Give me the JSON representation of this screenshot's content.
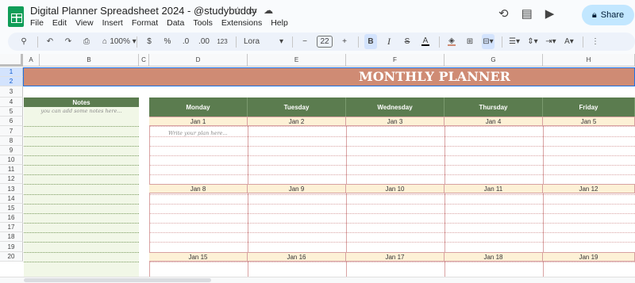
{
  "app": {
    "doc_title": "Digital Planner Spreadsheet 2024 - @studybuddy",
    "share_label": "Share",
    "menu": [
      "File",
      "Edit",
      "View",
      "Insert",
      "Format",
      "Data",
      "Tools",
      "Extensions",
      "Help"
    ],
    "icons": {
      "star": "star-icon",
      "folder": "move-folder-icon",
      "cloud": "cloud-status-icon",
      "history": "history-icon",
      "comment": "comment-icon",
      "meet": "meet-icon",
      "lock": "lock-icon"
    }
  },
  "toolbar": {
    "zoom": "100%",
    "currency": "$",
    "percent": "%",
    "dec_decrease": ".0",
    "dec_increase": ".00",
    "number_format": "123",
    "font": "Lora",
    "font_size": "22",
    "minus": "−",
    "plus": "+",
    "bold": "B",
    "italic": "I",
    "strike": "S",
    "text_color": "A"
  },
  "grid": {
    "columns": [
      "A",
      "B",
      "C",
      "D",
      "E",
      "F",
      "G",
      "H"
    ],
    "rows": [
      "1",
      "2",
      "3",
      "4",
      "5",
      "6",
      "7",
      "8",
      "9",
      "10",
      "11",
      "12",
      "13",
      "14",
      "15",
      "16",
      "17",
      "18",
      "19",
      "20"
    ]
  },
  "planner": {
    "title": "MONTHLY PLANNER",
    "notes_header": "Notes",
    "notes_hint": "you can add some notes here...",
    "plan_hint": "Write your plan here...",
    "days": [
      "Monday",
      "Tuesday",
      "Wednesday",
      "Thursday",
      "Friday"
    ],
    "weeks": [
      [
        "Jan 1",
        "Jan 2",
        "Jan 3",
        "Jan 4",
        "Jan 5"
      ],
      [
        "Jan 8",
        "Jan 9",
        "Jan 10",
        "Jan 11",
        "Jan 12"
      ],
      [
        "Jan 15",
        "Jan 16",
        "Jan 17",
        "Jan 18",
        "Jan 19"
      ]
    ]
  },
  "colors": {
    "banner": "#cf8b74",
    "header_green": "#5b7c4f",
    "date_fill": "#fdf1d6",
    "notes_fill": "#f1f7e7",
    "accent_blue": "#c2e7ff"
  }
}
